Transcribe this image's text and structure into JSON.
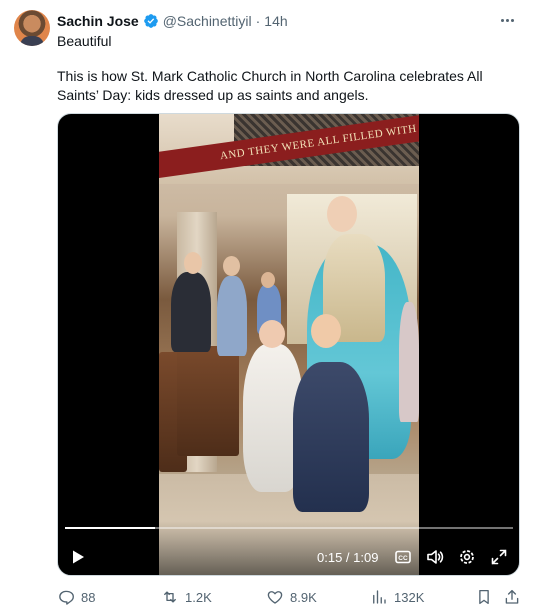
{
  "author": {
    "name": "Sachin Jose",
    "handle": "@Sachinettiyil",
    "separator": "·",
    "time": "14h",
    "verified": true
  },
  "tweet": {
    "line1": "Beautiful",
    "line2": "This is how St. Mark Catholic Church in North Carolina celebrates All Saints’ Day: kids dressed up as saints and angels."
  },
  "video": {
    "banner_text": "AND THEY WERE ALL FILLED WITH",
    "timecode": "0:15 / 1:09",
    "progress_fraction": 0.2,
    "icons": [
      "play-icon",
      "captions-icon",
      "volume-icon",
      "settings-icon",
      "fullscreen-icon"
    ]
  },
  "actions": {
    "replies": "88",
    "reposts": "1.2K",
    "likes": "8.9K",
    "views": "132K"
  },
  "colors": {
    "verified": "#1d9bf0",
    "muted": "#536471",
    "text": "#0f1419",
    "banner": "#8b1e1e"
  }
}
